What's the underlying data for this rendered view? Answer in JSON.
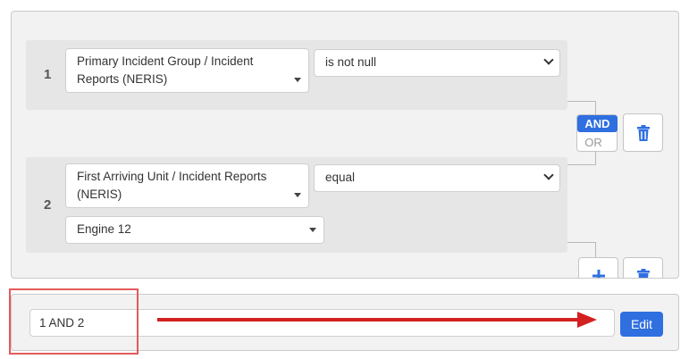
{
  "rules": [
    {
      "number": "1",
      "field_label": "Primary Incident Group / Incident Reports (NERIS)",
      "operator": "is not null"
    },
    {
      "number": "2",
      "field_label": "First Arriving Unit / Incident Reports (NERIS)",
      "operator": "equal",
      "value": "Engine 12"
    }
  ],
  "logic": {
    "and_label": "AND",
    "or_label": "OR",
    "selected": "AND"
  },
  "expression": {
    "value": "1 AND 2",
    "edit_label": "Edit"
  },
  "icons": {
    "delete": "trash-icon",
    "add": "plus-icon",
    "dropdown": "caret-down-icon"
  },
  "colors": {
    "primary": "#2f6fe0",
    "annotation": "#d32020"
  }
}
